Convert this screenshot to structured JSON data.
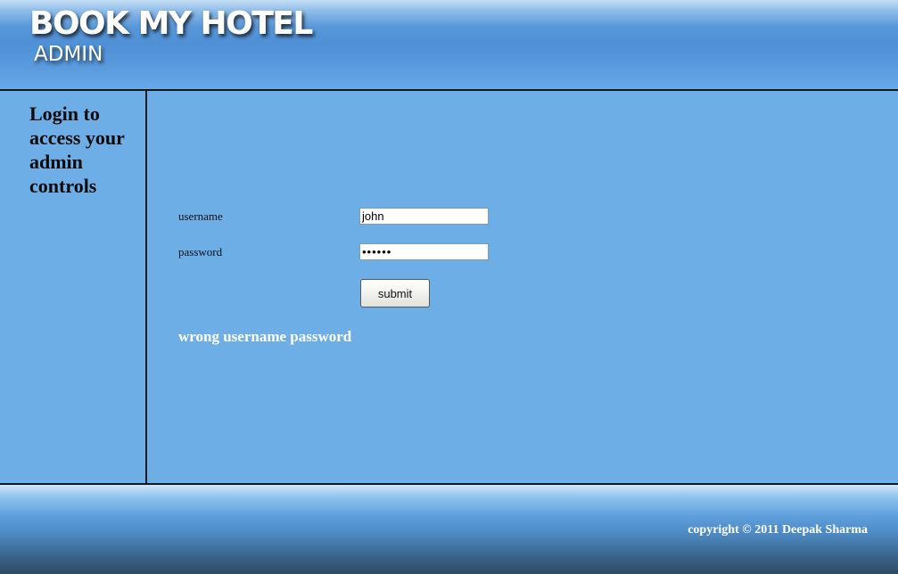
{
  "header": {
    "title": "BOOK MY HOTEL",
    "subtitle": "ADMIN"
  },
  "sidebar": {
    "text": "Login to access your admin controls"
  },
  "login_form": {
    "username_label": "username",
    "username_value": "john",
    "password_label": "password",
    "password_value": "secret",
    "submit_label": "submit",
    "error_message": "wrong username password"
  },
  "footer": {
    "copyright": "copyright © 2011 Deepak Sharma"
  }
}
